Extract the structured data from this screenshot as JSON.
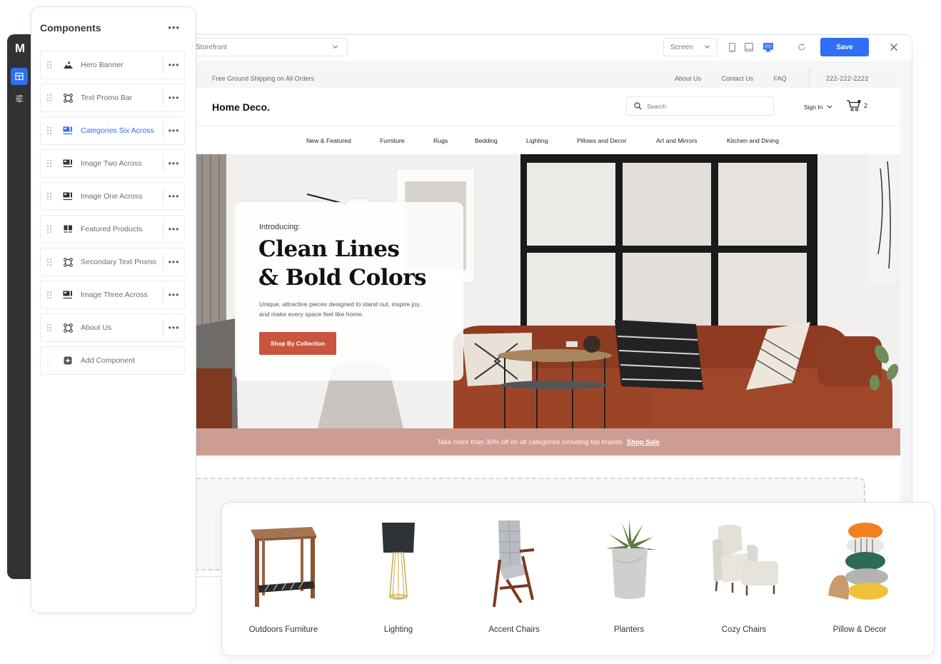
{
  "rail": {
    "logo": "M",
    "items": [
      {
        "name": "layout",
        "active": true
      },
      {
        "name": "settings",
        "active": false
      }
    ]
  },
  "panel": {
    "title": "Components",
    "more_label": "•••",
    "items": [
      {
        "label": "Hero Banner",
        "icon": "mountain-icon",
        "active": false
      },
      {
        "label": "Text Promo Bar",
        "icon": "promo-icon",
        "active": false
      },
      {
        "label": "Categories Six Across",
        "icon": "image-across-icon",
        "active": true
      },
      {
        "label": "Image Two Across",
        "icon": "image-across-icon",
        "active": false
      },
      {
        "label": "Image One Across",
        "icon": "image-across-icon",
        "active": false
      },
      {
        "label": "Featured Products",
        "icon": "grid-icon",
        "active": false
      },
      {
        "label": "Secondary Text Promo",
        "icon": "promo-icon",
        "active": false
      },
      {
        "label": "Image Three Across",
        "icon": "image-across-icon",
        "active": false
      },
      {
        "label": "About Us",
        "icon": "promo-icon",
        "active": false
      }
    ],
    "add_label": "Add Component"
  },
  "toolbar": {
    "page_select": "Storefront",
    "view_select": "Screen",
    "devices": [
      "mobile",
      "tablet",
      "desktop"
    ],
    "active_device": "desktop",
    "save_label": "Save",
    "colors": {
      "accent": "#2f6ef5"
    }
  },
  "store": {
    "utility": {
      "shipping": "Free Ground Shipping on All Orders",
      "links": [
        "About Us",
        "Contact Us",
        "FAQ"
      ],
      "phone": "222-222-2222"
    },
    "logo": "Home Deco.",
    "search_placeholder": "Search",
    "signin": "Sign In",
    "cart_count": "2",
    "nav": [
      "New & Featured",
      "Furniture",
      "Rugs",
      "Bedding",
      "Lighting",
      "Pillows and Decor",
      "Art and Mirrors",
      "Kitchen and Dining"
    ],
    "hero": {
      "intro": "Introducing:",
      "title_line1": "Clean Lines",
      "title_line2": "& Bold Colors",
      "description": "Unique, attractive pieces designed to stand out, inspire joy, and make every space feel like home.",
      "cta": "Shop By Collection",
      "cta_color": "#c9553e"
    },
    "promo": {
      "text": "Take more than 30% off on all categories including top brands",
      "link": "Shop Sale",
      "color": "#cd9d93"
    }
  },
  "categories": [
    {
      "label": "Outdoors Furniture",
      "image": "side-table"
    },
    {
      "label": "Lighting",
      "image": "floor-lamp"
    },
    {
      "label": "Accent Chairs",
      "image": "folding-chair"
    },
    {
      "label": "Planters",
      "image": "potted-plant"
    },
    {
      "label": "Cozy Chairs",
      "image": "armchair-ottoman"
    },
    {
      "label": "Pillow & Decor",
      "image": "pillow-stack"
    }
  ]
}
